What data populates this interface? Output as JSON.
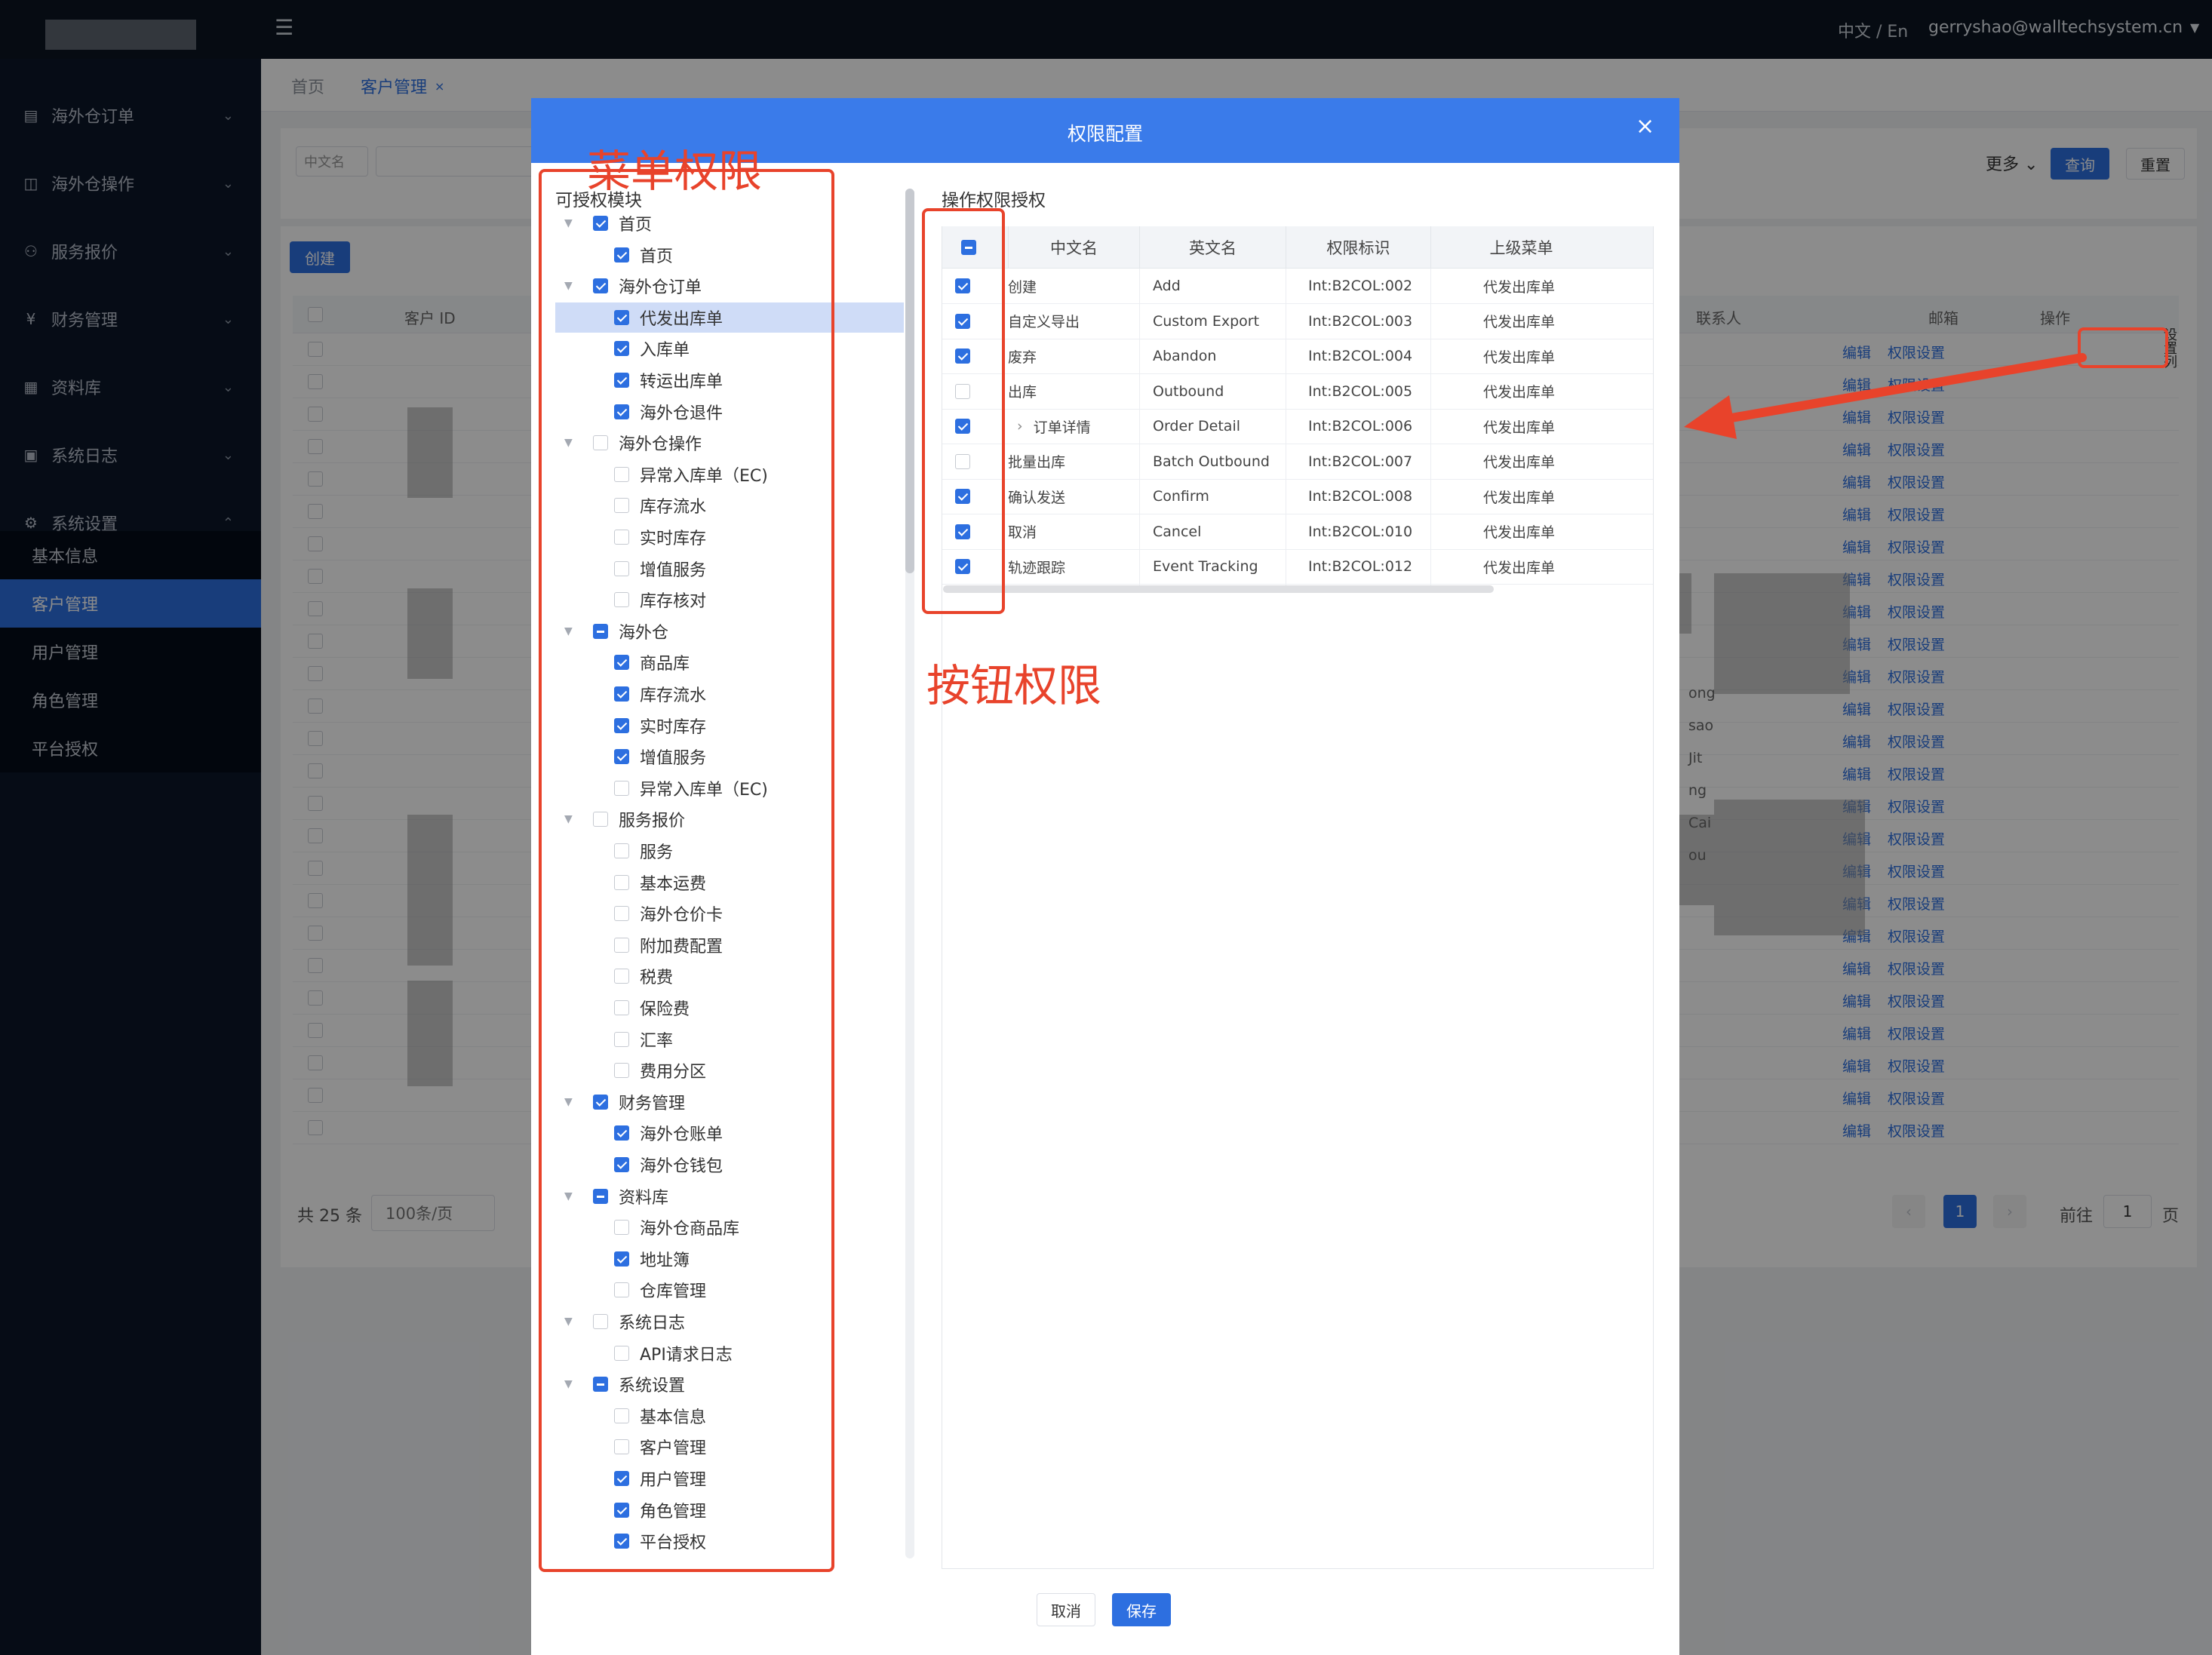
{
  "header": {
    "lang": "中文 / En",
    "user": "gerryshao@walltechsystem.cn"
  },
  "sidebar": {
    "items": [
      {
        "label": "海外仓订单",
        "icon": "order-icon"
      },
      {
        "label": "海外仓操作",
        "icon": "box-icon"
      },
      {
        "label": "服务报价",
        "icon": "share-icon"
      },
      {
        "label": "财务管理",
        "icon": "yen-icon"
      },
      {
        "label": "资料库",
        "icon": "grid-icon"
      },
      {
        "label": "系统日志",
        "icon": "calendar-icon"
      },
      {
        "label": "系统设置",
        "icon": "gear-icon"
      }
    ],
    "sub_items": [
      "基本信息",
      "客户管理",
      "用户管理",
      "角色管理",
      "平台授权"
    ]
  },
  "tabs": [
    {
      "label": "首页"
    },
    {
      "label": "客户管理"
    }
  ],
  "filter": {
    "lang_select": "中文名",
    "more": "更多",
    "query": "查询",
    "reset": "重置"
  },
  "list": {
    "create": "创建",
    "columns": {
      "id": "客户 ID",
      "contact": "联系人",
      "email": "邮箱",
      "op": "操作"
    },
    "op_edit": "编辑",
    "op_perm": "权限设置",
    "side_toggle": "设置列",
    "contact_fragments": [
      "ong",
      "sao",
      "Jit",
      "ng",
      "Cai",
      "ou"
    ],
    "total": "共 25 条",
    "page_size": "100条/页",
    "page_current": "1",
    "goto_label": "前往",
    "goto_value": "1",
    "page_unit": "页"
  },
  "modal": {
    "title": "权限配置",
    "left_title": "可授权模块",
    "right_title": "操作权限授权",
    "cancel": "取消",
    "save": "保存",
    "table_headers": [
      "中文名",
      "英文名",
      "权限标识",
      "上级菜单"
    ],
    "table_rows": [
      {
        "cn": "创建",
        "en": "Add",
        "code": "Int:B2COL:002",
        "parent": "代发出库单",
        "checked": true
      },
      {
        "cn": "自定义导出",
        "en": "Custom Export",
        "code": "Int:B2COL:003",
        "parent": "代发出库单",
        "checked": true
      },
      {
        "cn": "废弃",
        "en": "Abandon",
        "code": "Int:B2COL:004",
        "parent": "代发出库单",
        "checked": true
      },
      {
        "cn": "出库",
        "en": "Outbound",
        "code": "Int:B2COL:005",
        "parent": "代发出库单",
        "checked": false
      },
      {
        "cn": "订单详情",
        "en": "Order Detail",
        "code": "Int:B2COL:006",
        "parent": "代发出库单",
        "checked": true,
        "expand": true
      },
      {
        "cn": "批量出库",
        "en": "Batch Outbound",
        "code": "Int:B2COL:007",
        "parent": "代发出库单",
        "checked": false
      },
      {
        "cn": "确认发送",
        "en": "Confirm",
        "code": "Int:B2COL:008",
        "parent": "代发出库单",
        "checked": true
      },
      {
        "cn": "取消",
        "en": "Cancel",
        "code": "Int:B2COL:010",
        "parent": "代发出库单",
        "checked": true
      },
      {
        "cn": "轨迹跟踪",
        "en": "Event Tracking",
        "code": "Int:B2COL:012",
        "parent": "代发出库单",
        "checked": true
      }
    ],
    "tree": [
      {
        "label": "首页",
        "level": 0,
        "state": "on"
      },
      {
        "label": "首页",
        "level": 1,
        "state": "on"
      },
      {
        "label": "海外仓订单",
        "level": 0,
        "state": "on"
      },
      {
        "label": "代发出库单",
        "level": 1,
        "state": "on",
        "selected": true
      },
      {
        "label": "入库单",
        "level": 1,
        "state": "on"
      },
      {
        "label": "转运出库单",
        "level": 1,
        "state": "on"
      },
      {
        "label": "海外仓退件",
        "level": 1,
        "state": "on"
      },
      {
        "label": "海外仓操作",
        "level": 0,
        "state": "off"
      },
      {
        "label": "异常入库单（EC)",
        "level": 1,
        "state": "off"
      },
      {
        "label": "库存流水",
        "level": 1,
        "state": "off"
      },
      {
        "label": "实时库存",
        "level": 1,
        "state": "off"
      },
      {
        "label": "增值服务",
        "level": 1,
        "state": "off"
      },
      {
        "label": "库存核对",
        "level": 1,
        "state": "off"
      },
      {
        "label": "海外仓",
        "level": 0,
        "state": "ind"
      },
      {
        "label": "商品库",
        "level": 1,
        "state": "on"
      },
      {
        "label": "库存流水",
        "level": 1,
        "state": "on"
      },
      {
        "label": "实时库存",
        "level": 1,
        "state": "on"
      },
      {
        "label": "增值服务",
        "level": 1,
        "state": "on"
      },
      {
        "label": "异常入库单（EC)",
        "level": 1,
        "state": "off"
      },
      {
        "label": "服务报价",
        "level": 0,
        "state": "off"
      },
      {
        "label": "服务",
        "level": 1,
        "state": "off"
      },
      {
        "label": "基本运费",
        "level": 1,
        "state": "off"
      },
      {
        "label": "海外仓价卡",
        "level": 1,
        "state": "off"
      },
      {
        "label": "附加费配置",
        "level": 1,
        "state": "off"
      },
      {
        "label": "税费",
        "level": 1,
        "state": "off"
      },
      {
        "label": "保险费",
        "level": 1,
        "state": "off"
      },
      {
        "label": "汇率",
        "level": 1,
        "state": "off"
      },
      {
        "label": "费用分区",
        "level": 1,
        "state": "off"
      },
      {
        "label": "财务管理",
        "level": 0,
        "state": "on"
      },
      {
        "label": "海外仓账单",
        "level": 1,
        "state": "on"
      },
      {
        "label": "海外仓钱包",
        "level": 1,
        "state": "on"
      },
      {
        "label": "资料库",
        "level": 0,
        "state": "ind"
      },
      {
        "label": "海外仓商品库",
        "level": 1,
        "state": "off"
      },
      {
        "label": "地址簿",
        "level": 1,
        "state": "on"
      },
      {
        "label": "仓库管理",
        "level": 1,
        "state": "off"
      },
      {
        "label": "系统日志",
        "level": 0,
        "state": "off"
      },
      {
        "label": "API请求日志",
        "level": 1,
        "state": "off"
      },
      {
        "label": "系统设置",
        "level": 0,
        "state": "ind"
      },
      {
        "label": "基本信息",
        "level": 1,
        "state": "off"
      },
      {
        "label": "客户管理",
        "level": 1,
        "state": "off"
      },
      {
        "label": "用户管理",
        "level": 1,
        "state": "on"
      },
      {
        "label": "角色管理",
        "level": 1,
        "state": "on"
      },
      {
        "label": "平台授权",
        "level": 1,
        "state": "on"
      }
    ]
  },
  "annotations": {
    "menu_perm": "菜单权限",
    "button_perm": "按钮权限",
    "color": "#e8432b"
  }
}
